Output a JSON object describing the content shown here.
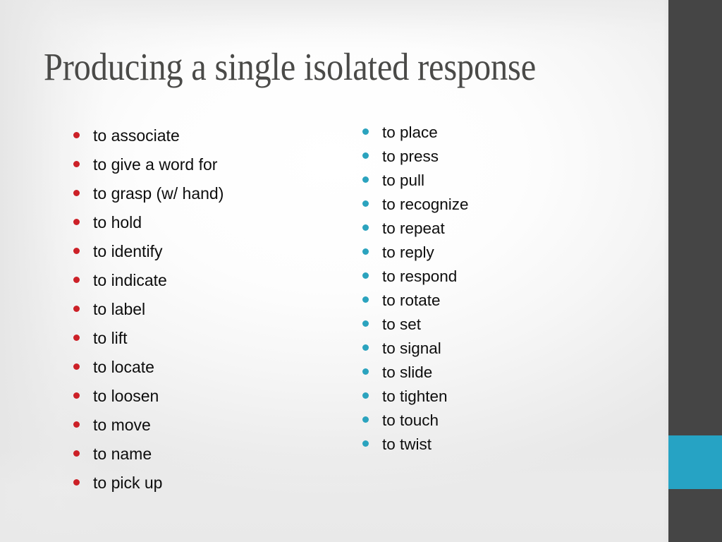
{
  "slide": {
    "title": "Producing a single isolated response",
    "title_color": "#4A4A48",
    "background_color": "#FDFDFD"
  },
  "columns": {
    "left": {
      "bullet_color": "#CC2027",
      "bullet_glyph": "round-bullet",
      "items": [
        "to associate",
        "to give a word for",
        "to grasp (w/ hand)",
        "to hold",
        "to identify",
        "to indicate",
        "to label",
        "to lift",
        "to locate",
        "to loosen",
        "to move",
        "to name",
        "to pick up"
      ]
    },
    "right": {
      "bullet_color": "#2BA3BE",
      "bullet_glyph": "round-bullet",
      "items": [
        "to place",
        "to press",
        "to pull",
        "to recognize",
        "to repeat",
        "to reply",
        "to respond",
        "to rotate",
        "to set",
        "to signal",
        "to slide",
        "to tighten",
        "to touch",
        "to twist"
      ]
    }
  },
  "decoration": {
    "side_bar_dark_color": "#454545",
    "side_bar_accent_color": "#26A3C4"
  }
}
